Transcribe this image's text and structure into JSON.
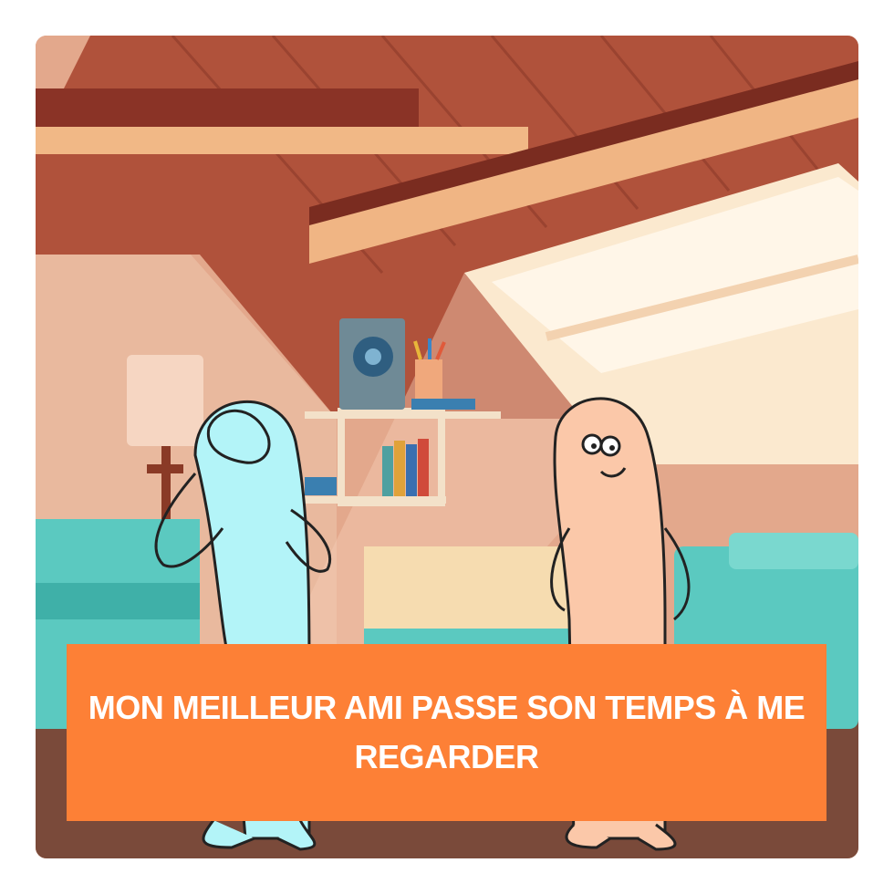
{
  "caption": {
    "text": "MON MEILLEUR AMI PASSE SON TEMPS À ME REGARDER"
  },
  "colors": {
    "caption_background": "#fd8036",
    "caption_text": "#ffffff",
    "left_character": "#b3f4f8",
    "right_character": "#fbc8a9",
    "sofa": "#5bc9c0",
    "roof": "#b0523b"
  },
  "scene": {
    "setting": "attic living room",
    "characters": [
      "blue-figure-facepalm",
      "peach-figure-smirk"
    ]
  }
}
